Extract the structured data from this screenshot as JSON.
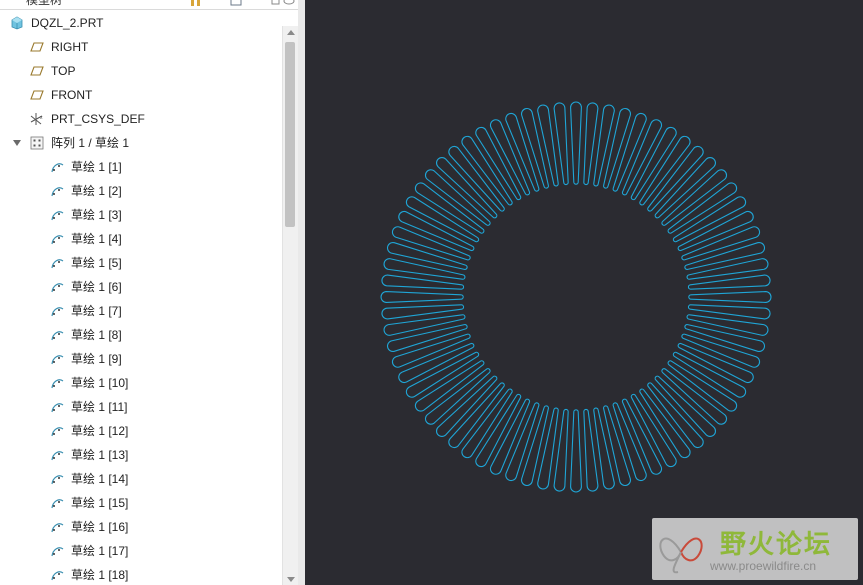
{
  "tree": {
    "header_title": "模型树",
    "root": "DQZL_2.PRT",
    "datums": [
      "RIGHT",
      "TOP",
      "FRONT"
    ],
    "csys": "PRT_CSYS_DEF",
    "pattern": "阵列 1 / 草绘 1",
    "sketches": [
      "草绘 1 [1]",
      "草绘 1 [2]",
      "草绘 1 [3]",
      "草绘 1 [4]",
      "草绘 1 [5]",
      "草绘 1 [6]",
      "草绘 1 [7]",
      "草绘 1 [8]",
      "草绘 1 [9]",
      "草绘 1 [10]",
      "草绘 1 [11]",
      "草绘 1 [12]",
      "草绘 1 [13]",
      "草绘 1 [14]",
      "草绘 1 [15]",
      "草绘 1 [16]",
      "草绘 1 [17]",
      "草绘 1 [18]"
    ]
  },
  "icons": {
    "part": "part-icon",
    "datum_plane": "datum-plane-icon",
    "csys": "coordinate-system-icon",
    "pattern": "pattern-icon",
    "sketch": "sketch-icon",
    "expand": "expand-arrow-icon"
  },
  "viewport": {
    "background": "#2b2b31",
    "curve_color": "#1fa5d6",
    "slot_count": 72
  },
  "watermark": {
    "title": "野火论坛",
    "url": "www.proewildfire.cn"
  }
}
